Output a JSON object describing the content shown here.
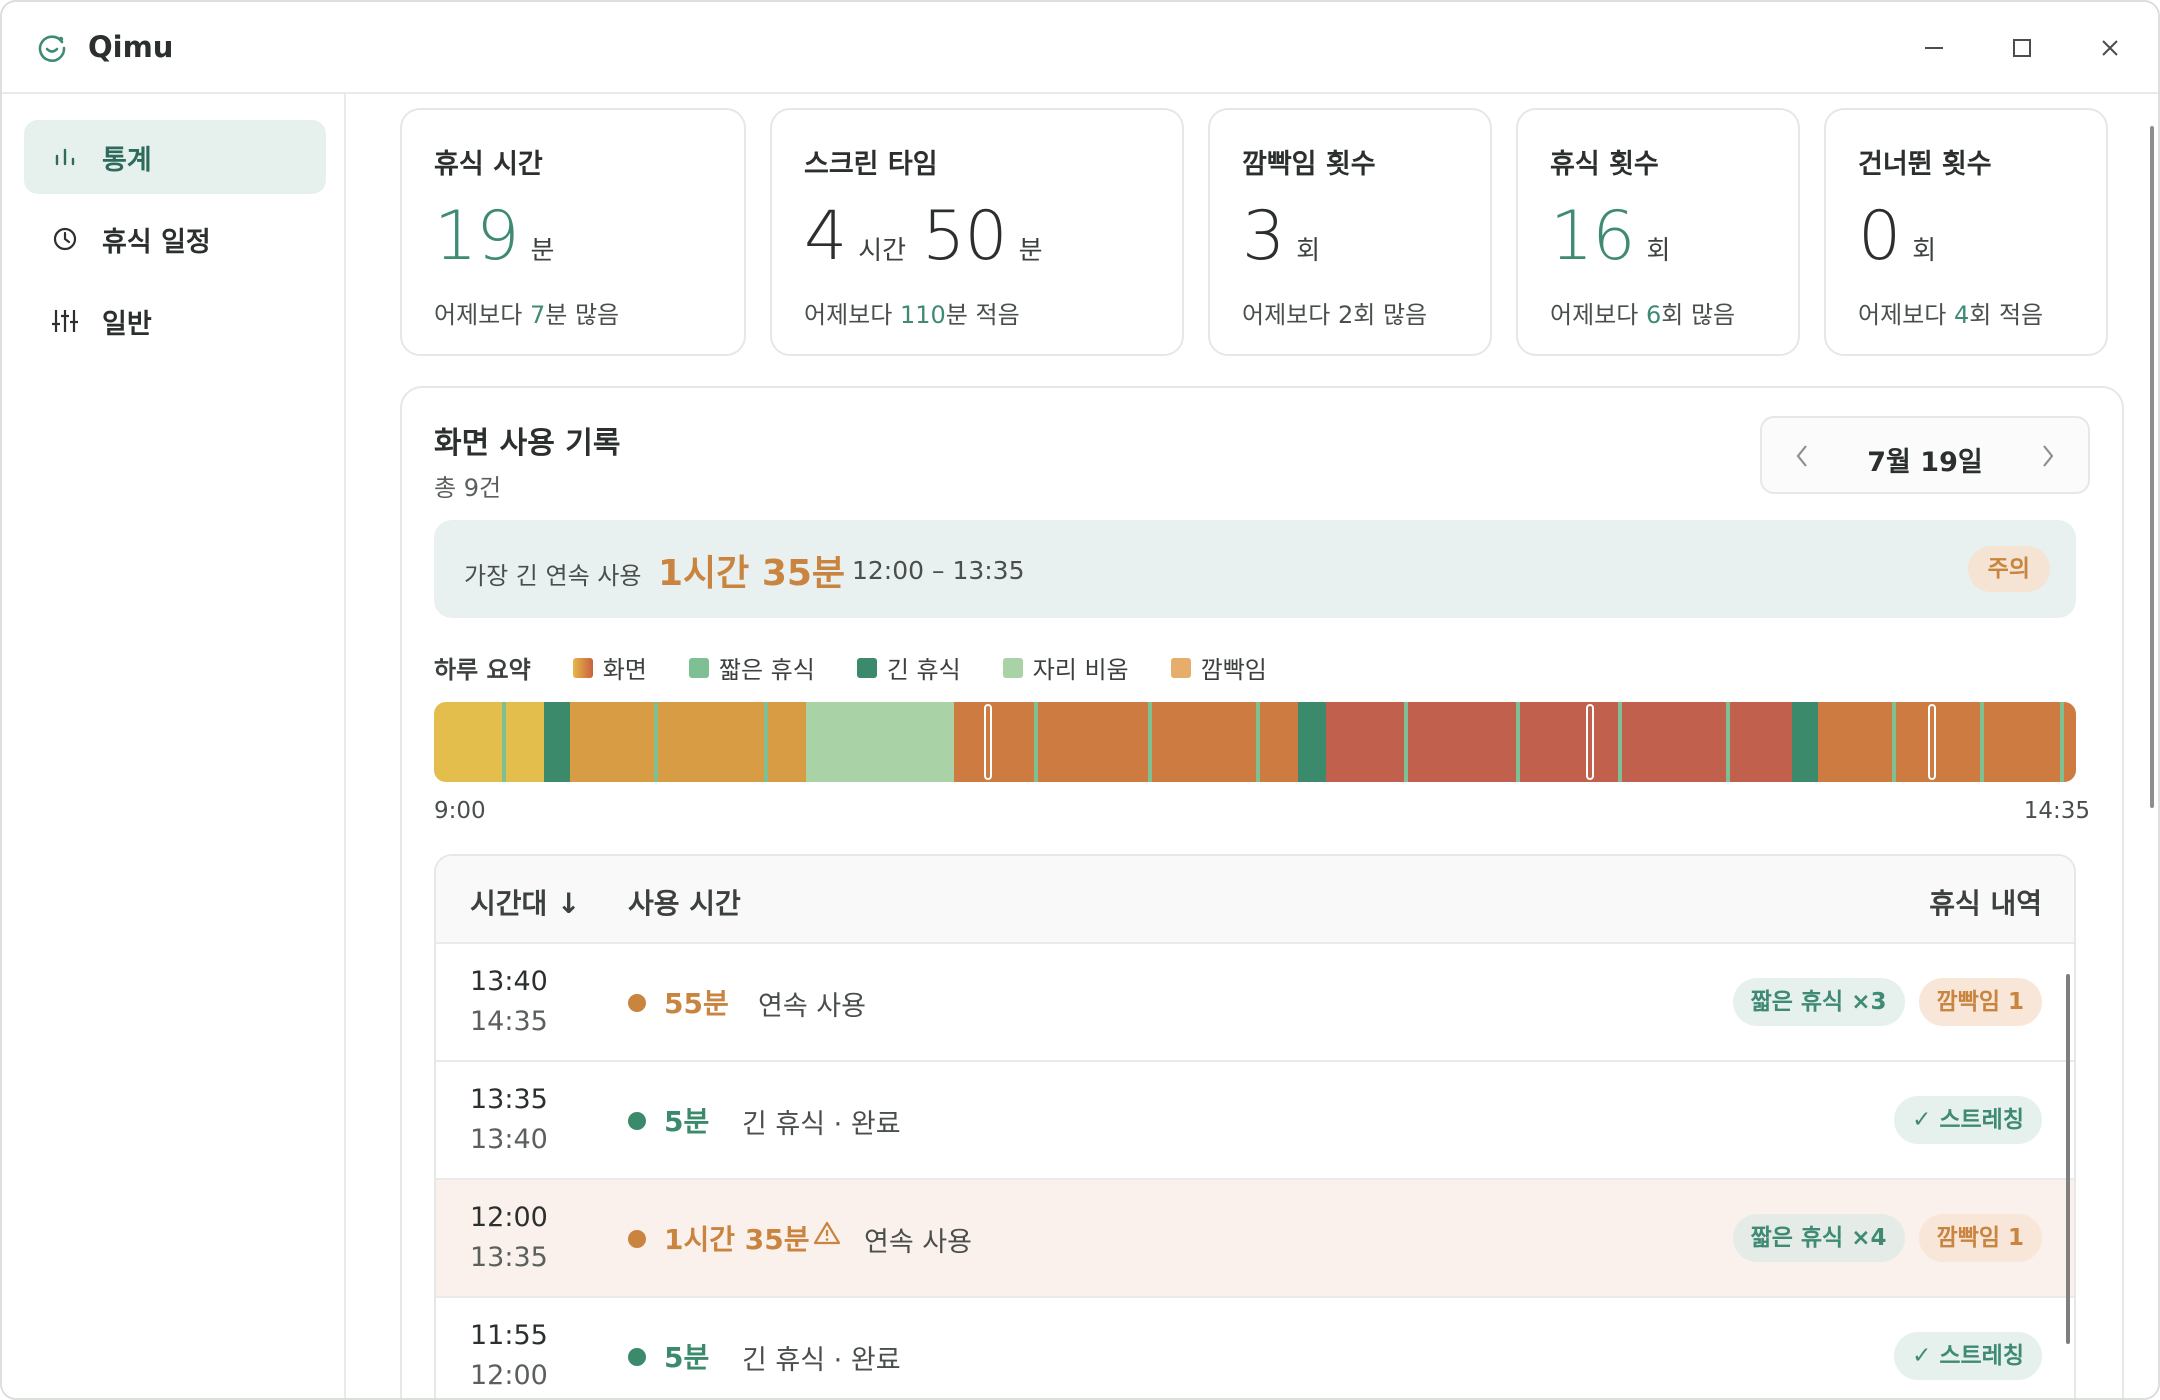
{
  "app": {
    "title": "Qimu"
  },
  "sidebar": {
    "items": [
      {
        "label": "통계",
        "icon": "bar-chart-icon",
        "active": true
      },
      {
        "label": "휴식 일정",
        "icon": "clock-icon",
        "active": false
      },
      {
        "label": "일반",
        "icon": "sliders-icon",
        "active": false
      }
    ]
  },
  "stats": [
    {
      "title": "휴식 시간",
      "value": "19",
      "unit": "분",
      "sub_pre": "어제보다",
      "sub_num": "7",
      "sub_post": "분 많음"
    },
    {
      "title": "스크린 타임",
      "value": "4",
      "unit": "시간",
      "value2": "50",
      "unit2": "분",
      "sub_pre": "어제보다",
      "sub_num": "110",
      "sub_post": "분 적음"
    },
    {
      "title": "깜빡임 횟수",
      "value": "3",
      "unit": "회",
      "sub_pre": "어제보다",
      "sub_num": "2",
      "sub_post": "회 많음"
    },
    {
      "title": "휴식 횟수",
      "value": "16",
      "unit": "회",
      "sub_pre": "어제보다",
      "sub_num": "6",
      "sub_post": "회 많음"
    },
    {
      "title": "건너뛴 횟수",
      "value": "0",
      "unit": "회",
      "sub_pre": "어제보다",
      "sub_num": "4",
      "sub_post": "회 적음"
    }
  ],
  "history": {
    "title": "화면 사용 기록",
    "count": "총 9건",
    "date": "7월 19일",
    "longest_label": "가장 긴 연속 사용",
    "longest_value": "1시간 35분",
    "longest_range": "12:00 – 13:35",
    "longest_badge": "주의",
    "legend_title": "하루 요약",
    "legend": [
      {
        "label": "화면",
        "color": "#d9a24a"
      },
      {
        "label": "짧은 휴식",
        "color": "#7fbf94"
      },
      {
        "label": "긴 휴식",
        "color": "#3b8a6c"
      },
      {
        "label": "자리 비움",
        "color": "#a9d3a6"
      },
      {
        "label": "깜빡임",
        "color": "#e6ad6b"
      }
    ],
    "timeline_start": "9:00",
    "timeline_end": "14:35",
    "table": {
      "col_time": "시간대 ↓",
      "col_usage": "사용 시간",
      "col_breaks": "휴식 내역",
      "rows": [
        {
          "start": "13:40",
          "end": "14:35",
          "duration": "55분",
          "kind": "screen",
          "desc": "연속 사용",
          "badges": [
            {
              "text": "짧은 휴식 ×3",
              "tone": "green"
            },
            {
              "text": "깜빡임 1",
              "tone": "orange"
            }
          ]
        },
        {
          "start": "13:35",
          "end": "13:40",
          "duration": "5분",
          "kind": "break",
          "desc": "긴 휴식 · 완료",
          "badges": [
            {
              "text": "✓ 스트레칭",
              "tone": "green"
            }
          ]
        },
        {
          "start": "12:00",
          "end": "13:35",
          "duration": "1시간 35분",
          "kind": "screen",
          "warn": true,
          "desc": "연속 사용",
          "badges": [
            {
              "text": "짧은 휴식 ×4",
              "tone": "green"
            },
            {
              "text": "깜빡임 1",
              "tone": "orange"
            }
          ]
        },
        {
          "start": "11:55",
          "end": "12:00",
          "duration": "5분",
          "kind": "break",
          "desc": "긴 휴식 · 완료",
          "badges": [
            {
              "text": "✓ 스트레칭",
              "tone": "green"
            }
          ]
        }
      ]
    }
  }
}
